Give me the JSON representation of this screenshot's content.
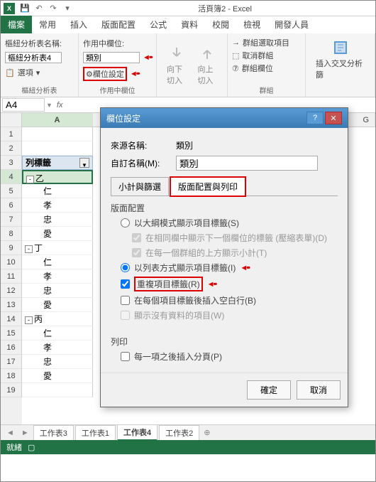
{
  "titlebar": {
    "app_title": "活頁簿2 - Excel"
  },
  "tabs": {
    "file": "檔案",
    "home": "常用",
    "insert": "插入",
    "layout": "版面配置",
    "formula": "公式",
    "data": "資料",
    "review": "校閱",
    "view": "檢視",
    "dev": "開發人員"
  },
  "ribbon": {
    "pivot_name_label": "樞紐分析表名稱:",
    "pivot_name": "樞紐分析表4",
    "options": "選項",
    "group_pivot": "樞紐分析表",
    "active_field_label": "作用中欄位:",
    "active_field": "類別",
    "field_settings": "欄位設定",
    "group_active": "作用中欄位",
    "drill_down": "向下切入",
    "drill_up": "向上切入",
    "group_sel": "群組選取項目",
    "ungroup": "取消群組",
    "group_field": "群組欄位",
    "group_group": "群組",
    "insert_slicer": "插入交叉分析篩"
  },
  "namebox": "A4",
  "columns": {
    "a": "A",
    "g": "G"
  },
  "pivot": {
    "row_label": "列標籤",
    "groups": [
      {
        "name": "乙",
        "items": [
          "仁",
          "孝",
          "忠",
          "愛"
        ]
      },
      {
        "name": "丁",
        "items": [
          "仁",
          "孝",
          "忠",
          "愛"
        ]
      },
      {
        "name": "丙",
        "items": [
          "仁",
          "孝",
          "忠",
          "愛"
        ]
      }
    ]
  },
  "sheets": {
    "s3": "工作表3",
    "s1": "工作表1",
    "s4": "工作表4",
    "s2": "工作表2"
  },
  "status": {
    "ready": "就緒",
    "rec": ""
  },
  "dialog": {
    "title": "欄位設定",
    "source_label": "來源名稱:",
    "source_value": "類別",
    "custom_label": "自訂名稱(M):",
    "custom_value": "類別",
    "tab1": "小計與篩選",
    "tab2": "版面配置與列印",
    "sec_layout": "版面配置",
    "opt_outline": "以大綱模式顯示項目標籤(S)",
    "opt_same_col": "在相同欄中顯示下一個欄位的標籤 (壓縮表單)(D)",
    "opt_subtotal_top": "在每一個群組的上方顯示小計(T)",
    "opt_tabular": "以列表方式顯示項目標籤(I)",
    "opt_repeat": "重複項目標籤(R)",
    "opt_blank": "在每個項目標籤後插入空白行(B)",
    "opt_nodata": "顯示沒有資料的項目(W)",
    "sec_print": "列印",
    "opt_pagebreak": "每一項之後插入分頁(P)",
    "ok": "確定",
    "cancel": "取消"
  }
}
